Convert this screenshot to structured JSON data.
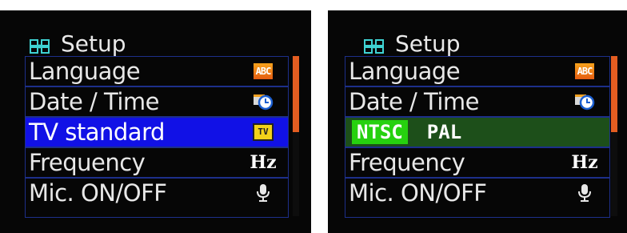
{
  "screens": [
    {
      "title": "Setup",
      "items": [
        {
          "label": "Language",
          "icon": "abc-icon",
          "icon_text": "ABC"
        },
        {
          "label": "Date / Time",
          "icon": "clock-calendar-icon"
        },
        {
          "label": "TV standard",
          "icon": "tv-icon",
          "icon_text": "TV",
          "selected": true
        },
        {
          "label": "Frequency",
          "icon": "hz-icon",
          "icon_text": "Hz"
        },
        {
          "label": "Mic. ON/OFF",
          "icon": "microphone-icon"
        }
      ]
    },
    {
      "title": "Setup",
      "items": [
        {
          "label": "Language",
          "icon": "abc-icon",
          "icon_text": "ABC"
        },
        {
          "label": "Date / Time",
          "icon": "clock-calendar-icon"
        },
        {
          "options": [
            "NTSC",
            "PAL"
          ],
          "selected_option": "NTSC"
        },
        {
          "label": "Frequency",
          "icon": "hz-icon",
          "icon_text": "Hz"
        },
        {
          "label": "Mic. ON/OFF",
          "icon": "microphone-icon"
        }
      ]
    }
  ],
  "colors": {
    "selection_blue": "#1111e6",
    "option_row_green": "#1d4f1a",
    "option_active_green": "#26d10f",
    "scroll_thumb_orange": "#e35d21",
    "border_blue": "#1d2f8a"
  }
}
